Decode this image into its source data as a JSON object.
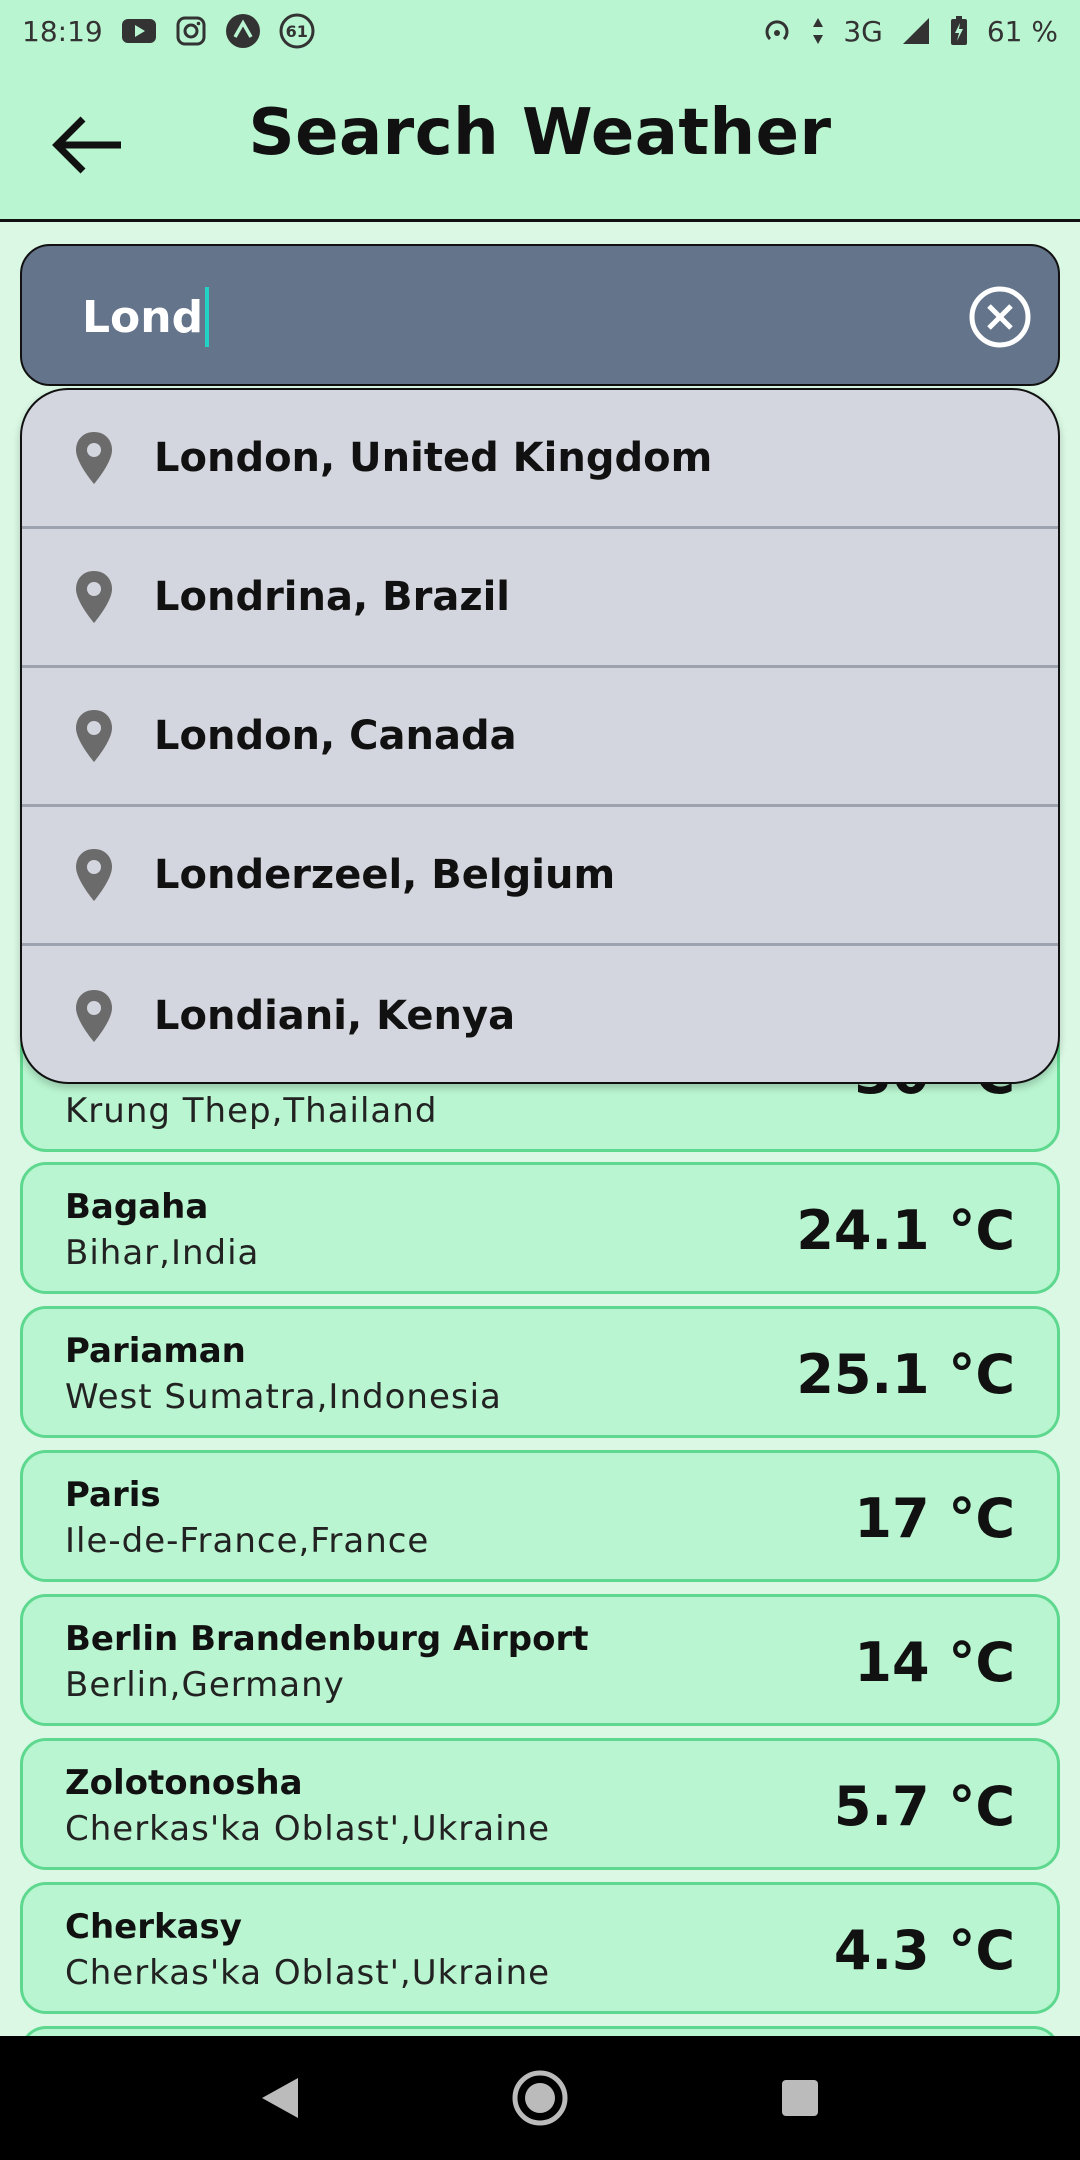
{
  "status_bar": {
    "time": "18:19",
    "notification_badge": "61",
    "network": "3G",
    "battery": "61 %"
  },
  "app_bar": {
    "title": "Search Weather"
  },
  "search": {
    "value": "Lond",
    "colors": {
      "field": "#64748b",
      "caret": "#22d3c5"
    }
  },
  "suggestions": [
    {
      "label": "London, United Kingdom",
      "icon": "location-pin-icon"
    },
    {
      "label": "Londrina, Brazil",
      "icon": "location-pin-icon"
    },
    {
      "label": "London, Canada",
      "icon": "location-pin-icon"
    },
    {
      "label": "Londerzeel, Belgium",
      "icon": "location-pin-icon"
    },
    {
      "label": "Londiani, Kenya",
      "icon": "location-pin-icon"
    }
  ],
  "results": [
    {
      "city": "",
      "region": "Krung Thep,Thailand",
      "temp": "30 °C"
    },
    {
      "city": "Bagaha",
      "region": "Bihar,India",
      "temp": "24.1 °C"
    },
    {
      "city": "Pariaman",
      "region": "West Sumatra,Indonesia",
      "temp": "25.1 °C"
    },
    {
      "city": "Paris",
      "region": "Ile-de-France,France",
      "temp": "17 °C"
    },
    {
      "city": "Berlin Brandenburg Airport",
      "region": "Berlin,Germany",
      "temp": "14 °C"
    },
    {
      "city": "Zolotonosha",
      "region": "Cherkas'ka Oblast',Ukraine",
      "temp": "5.7 °C"
    },
    {
      "city": "Cherkasy",
      "region": "Cherkas'ka Oblast',Ukraine",
      "temp": "4.3 °C"
    }
  ],
  "theme": {
    "background": "#daf8e4",
    "card": "#b9f5d0",
    "card_border": "#5ed88e",
    "dropdown": "#d3d6de"
  }
}
